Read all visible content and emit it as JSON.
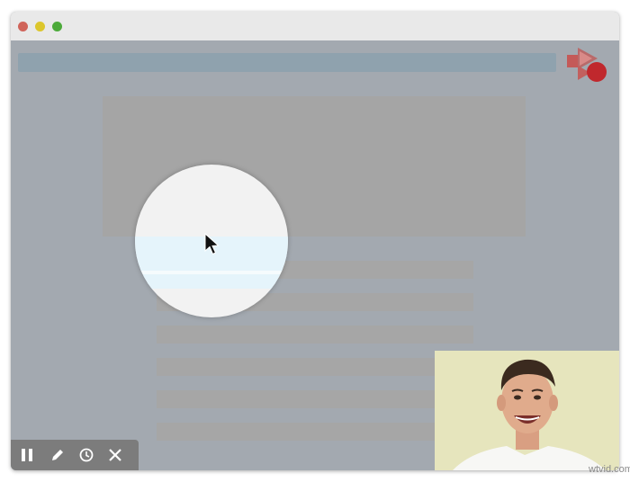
{
  "window": {
    "controls": [
      "close",
      "minimize",
      "maximize"
    ]
  },
  "toolbar": {
    "buttons": [
      {
        "name": "pause",
        "icon": "pause-icon"
      },
      {
        "name": "draw",
        "icon": "pencil-icon"
      },
      {
        "name": "timer",
        "icon": "clock-icon"
      },
      {
        "name": "close",
        "icon": "close-icon"
      }
    ]
  },
  "recorder": {
    "logo_icon": "record-camera-icon",
    "accent_color": "#c0282d"
  },
  "cursor": {
    "icon": "mouse-pointer-icon",
    "highlight": "spotlight"
  },
  "webcam": {
    "content": "presenter-video-overlay"
  },
  "watermark": {
    "text": "wtvid.com"
  },
  "colors": {
    "overlay": "#a3a9b0",
    "address_bar": "#8fa2ae",
    "toolbar": "#7c7c7c",
    "webcam_bg": "#e6e5bd"
  }
}
